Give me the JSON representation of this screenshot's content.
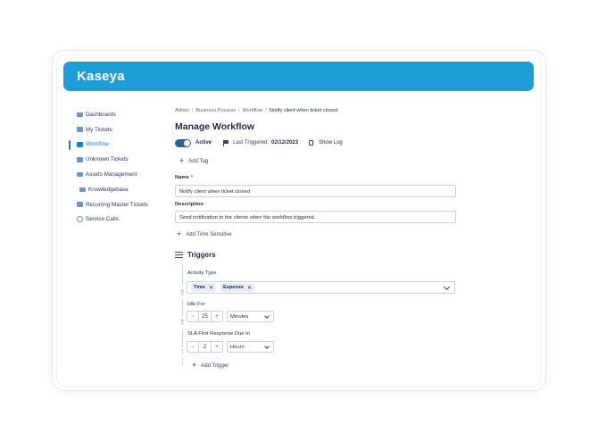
{
  "brand": {
    "logo": "Kaseya"
  },
  "sidebar": {
    "items": [
      {
        "label": "Dashboards",
        "icon": "dashboard-icon"
      },
      {
        "label": "My Tickets",
        "icon": "ticket-icon"
      },
      {
        "label": "Workflow",
        "icon": "workflow-icon",
        "active": true
      },
      {
        "label": "Unknown Tickets",
        "icon": "unknown-ticket-icon"
      },
      {
        "label": "Assets Management",
        "icon": "assets-icon"
      },
      {
        "label": "Knowledgebase",
        "icon": "knowledgebase-icon"
      },
      {
        "label": "Recurring Master Tickets",
        "icon": "recurring-icon"
      },
      {
        "label": "Service Calls",
        "icon": "service-calls-icon"
      }
    ]
  },
  "breadcrumb": {
    "items": [
      "Admin",
      "Business Process",
      "Workflow",
      "Notify client when ticket closed"
    ]
  },
  "page": {
    "title": "Manage Workflow"
  },
  "status": {
    "active_label": "Active",
    "last_triggered_label": "Last Triggered:",
    "last_triggered_value": "02/12/2023",
    "show_log_label": "Show Log"
  },
  "actions": {
    "add_tag": "Add Tag",
    "add_time_sensitive": "Add Time Sensitive",
    "add_trigger": "Add Trigger"
  },
  "form": {
    "name_label": "Name",
    "name_required": "*",
    "name_value": "Notify client when ticket closed",
    "description_label": "Description",
    "description_value": "Send notification to the clients when the workflow triggered."
  },
  "triggers": {
    "title": "Triggers",
    "or_label": "OR",
    "activity_type": {
      "label": "Activity Type",
      "chips": [
        "Time",
        "Expense"
      ]
    },
    "idle_for": {
      "label": "Idle For",
      "value": "25",
      "unit": "Minutes"
    },
    "sla": {
      "label": "SLA First Response Due In",
      "value": "2",
      "unit": "Hours"
    }
  },
  "colors": {
    "header": "#1d9ed8",
    "active_nav": "#1c7fce",
    "toggle": "#2d5f8f"
  }
}
